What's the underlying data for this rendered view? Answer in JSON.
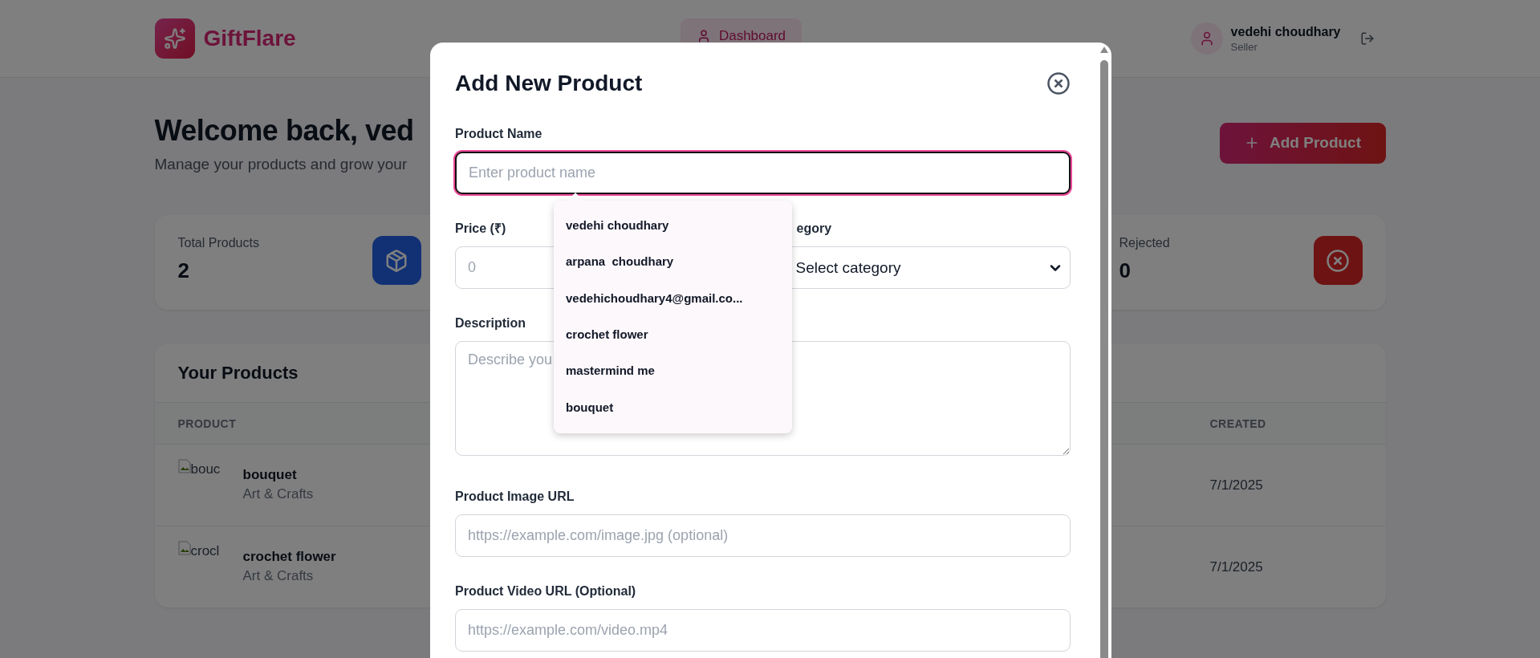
{
  "header": {
    "brand": "GiftFlare",
    "nav": [
      {
        "label": "Dashboard",
        "selected": true
      }
    ],
    "user": {
      "name": "vedehi choudhary",
      "role": "Seller"
    }
  },
  "welcome": {
    "title": "Welcome back, ved",
    "subtitle": "Manage your products and grow your"
  },
  "add_button": "Add Product",
  "stats": [
    {
      "label": "Total Products",
      "value": "2",
      "kind": "box"
    },
    {
      "label": "Rejected",
      "value": "0",
      "kind": "reject"
    }
  ],
  "products": {
    "title": "Your Products",
    "columns": [
      "PRODUCT",
      "CREATED"
    ],
    "rows": [
      {
        "alt": "bouc",
        "name": "bouquet",
        "category": "Art & Crafts",
        "created": "7/1/2025"
      },
      {
        "alt": "crocl",
        "name": "crochet flower",
        "category": "Art & Crafts",
        "created": "7/1/2025"
      }
    ]
  },
  "modal": {
    "title": "Add New Product",
    "fields": [
      {
        "kind": "text",
        "label": "Product Name",
        "placeholder": "Enter product name",
        "focused": true
      },
      {
        "kind": "pair",
        "items": [
          {
            "kind": "text",
            "label": "Price (₹)",
            "placeholder": "0",
            "focused": false
          },
          {
            "kind": "select",
            "label": "egory",
            "value": "Select category"
          }
        ]
      },
      {
        "kind": "textarea",
        "label": "Description",
        "placeholder": "Describe you"
      },
      {
        "kind": "text",
        "label": "Product Image URL",
        "placeholder": "https://example.com/image.jpg (optional)",
        "focused": false
      },
      {
        "kind": "text",
        "label": "Product Video URL (Optional)",
        "placeholder": "https://example.com/video.mp4",
        "focused": false
      }
    ],
    "suggestions": [
      "vedehi choudhary",
      "arpana  choudhary",
      "vedehichoudhary4@gmail.co...",
      "crochet flower",
      "mastermind me",
      "bouquet"
    ]
  }
}
